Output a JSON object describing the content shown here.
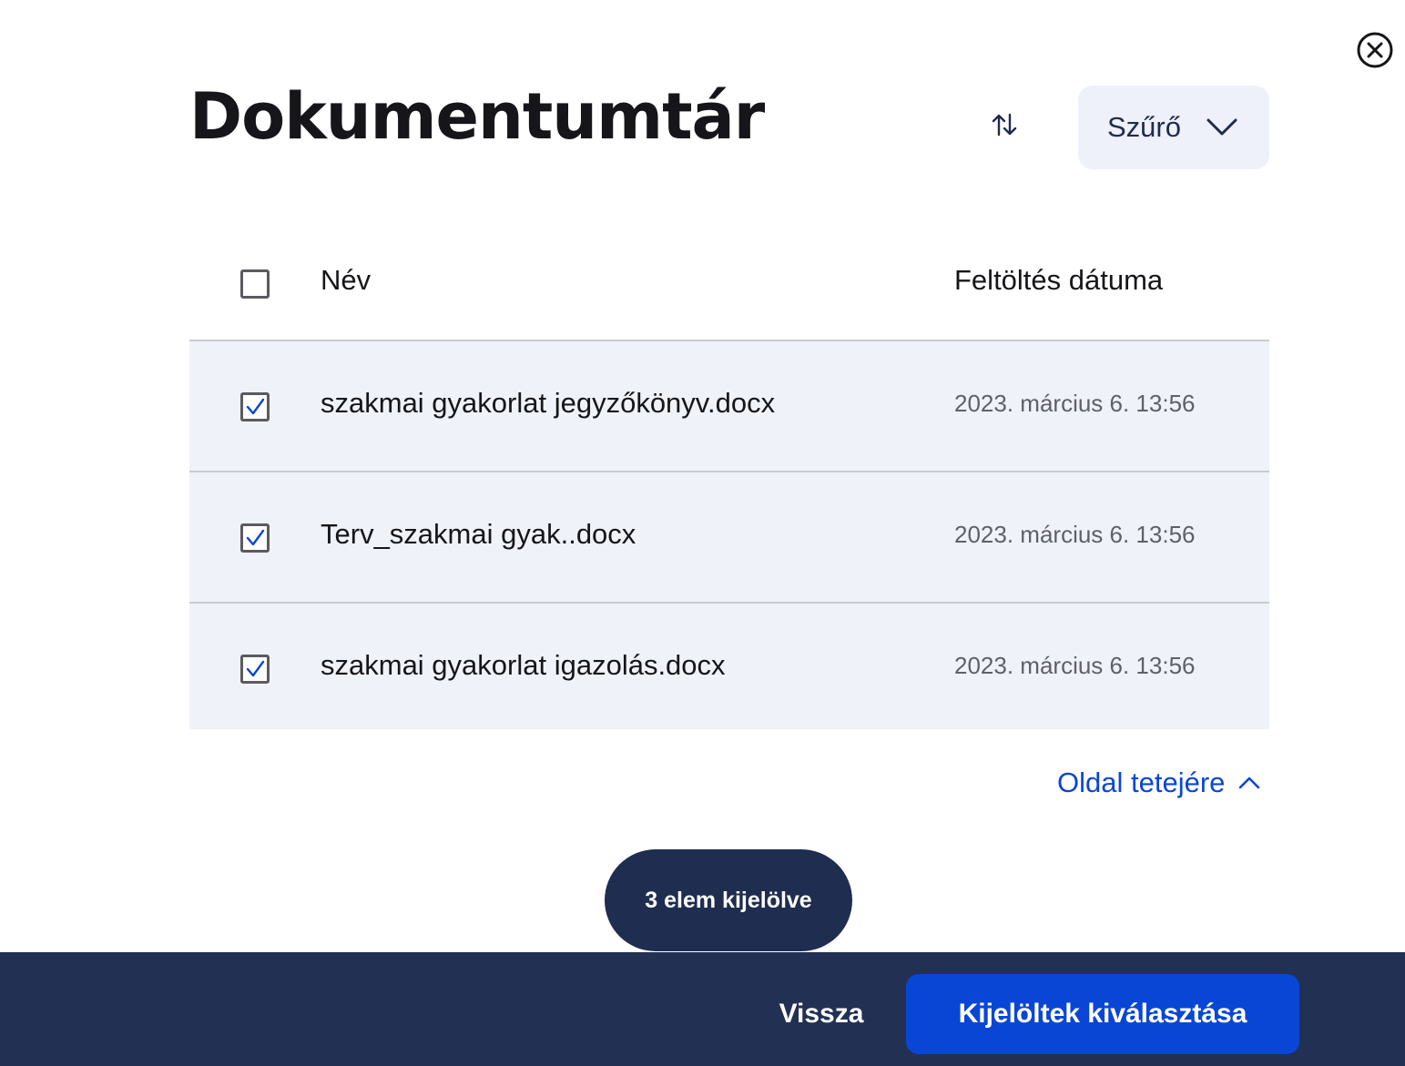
{
  "dialog": {
    "title": "Dokumentumtár",
    "close_icon": "close-circle-icon"
  },
  "toolbar": {
    "sort_icon": "sort-arrows-icon",
    "filter_label": "Szűrő",
    "filter_icon": "chevron-down-icon"
  },
  "table": {
    "columns": {
      "name": "Név",
      "date": "Feltöltés dátuma"
    },
    "select_all_checked": false,
    "rows": [
      {
        "name": "szakmai gyakorlat jegyzőkönyv.docx",
        "date": "2023. március 6. 13:56",
        "checked": true
      },
      {
        "name": "Terv_szakmai gyak..docx",
        "date": "2023. március 6. 13:56",
        "checked": true
      },
      {
        "name": "szakmai gyakorlat igazolás.docx",
        "date": "2023. március 6. 13:56",
        "checked": true
      }
    ]
  },
  "scroll_top": {
    "label": "Oldal tetejére",
    "icon": "chevron-up-icon"
  },
  "selection": {
    "label": "3 elem kijelölve"
  },
  "footer": {
    "back_label": "Vissza",
    "primary_label": "Kijelöltek kiválasztása"
  },
  "colors": {
    "accent": "#0a46d6",
    "navy": "#223054",
    "row_bg": "#f0f2f9"
  }
}
